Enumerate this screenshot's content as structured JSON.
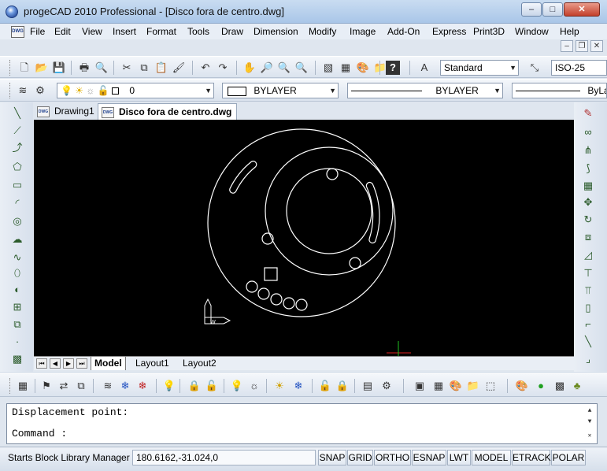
{
  "window": {
    "title": "progeCAD 2010 Professional - [Disco fora de centro.dwg]",
    "minimize_label": "–",
    "maximize_label": "□",
    "close_label": "✕"
  },
  "menubar": {
    "doc_icon_label": "DWG",
    "items": [
      "File",
      "Edit",
      "View",
      "Insert",
      "Format",
      "Tools",
      "Draw",
      "Dimension",
      "Modify",
      "Image",
      "Add-On",
      "Express",
      "Print3D",
      "Window",
      "Help"
    ],
    "mdi_minimize": "–",
    "mdi_restore": "❐",
    "mdi_close": "✕"
  },
  "standard_toolbar": {
    "text_style": "Standard",
    "dim_style": "ISO-25"
  },
  "properties_toolbar": {
    "layer": "0",
    "color": "BYLAYER",
    "linetype": "BYLAYER",
    "lineweight": "ByLa"
  },
  "document_tabs": [
    {
      "label": "Drawing1",
      "icon": "DWG"
    },
    {
      "label": "Disco fora de centro.dwg",
      "icon": "DWG"
    }
  ],
  "layout_tabs": [
    "Model",
    "Layout1",
    "Layout2"
  ],
  "command": {
    "line1": "Displacement point:",
    "line2": "Command :"
  },
  "status": {
    "message": "Starts Block Library Manager",
    "coordinates": "180.6162,-31.024,0",
    "toggles": [
      "SNAP",
      "GRID",
      "ORTHO",
      "ESNAP",
      "LWT",
      "MODEL",
      "ETRACK",
      "POLAR"
    ]
  },
  "colors": {
    "canvas_background": "#000000",
    "geometry_stroke": "#ffffff",
    "crosshair_x": "#e02020",
    "crosshair_y": "#20c020"
  }
}
